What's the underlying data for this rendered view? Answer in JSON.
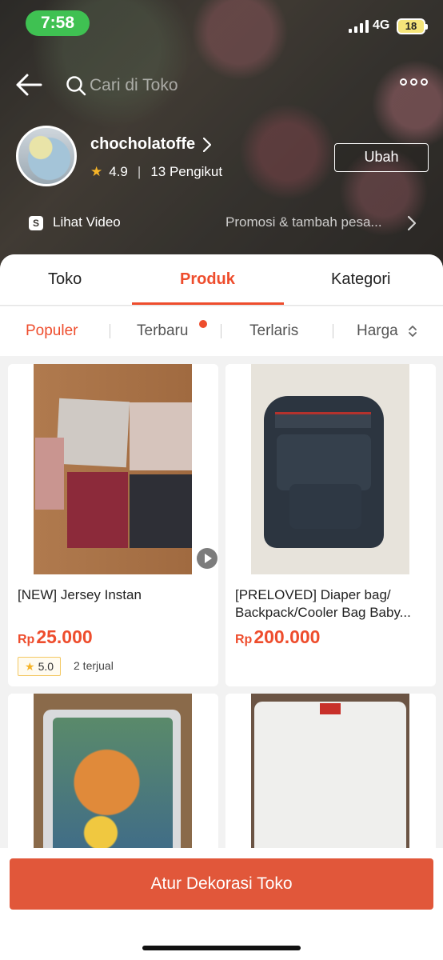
{
  "status": {
    "time": "7:58",
    "network": "4G",
    "battery": "18"
  },
  "search": {
    "placeholder": "Cari di Toko"
  },
  "shop": {
    "name": "chocholatoffe",
    "rating": "4.9",
    "followers": "13 Pengikut",
    "edit_label": "Ubah",
    "video_label": "Lihat Video",
    "promo_label": "Promosi & tambah pesa..."
  },
  "tabs": [
    {
      "label": "Toko"
    },
    {
      "label": "Produk"
    },
    {
      "label": "Kategori"
    }
  ],
  "active_tab": "Produk",
  "sort": [
    {
      "label": "Populer"
    },
    {
      "label": "Terbaru"
    },
    {
      "label": "Terlaris"
    },
    {
      "label": "Harga"
    }
  ],
  "products": [
    {
      "title": "[NEW] Jersey Instan",
      "currency": "Rp",
      "price": "25.000",
      "rating": "5.0",
      "sold": "2 terjual"
    },
    {
      "title": "[PRELOVED] Diaper bag/ Backpack/Cooler Bag Baby...",
      "currency": "Rp",
      "price": "200.000"
    },
    {
      "title": "",
      "currency": "",
      "price": ""
    },
    {
      "title": "",
      "currency": "",
      "price": ""
    }
  ],
  "cta": {
    "label": "Atur Dekorasi Toko"
  },
  "colors": {
    "accent": "#ee4d2d",
    "cta": "#e1573a",
    "status_green": "#3fc152",
    "star": "#f6b428"
  }
}
